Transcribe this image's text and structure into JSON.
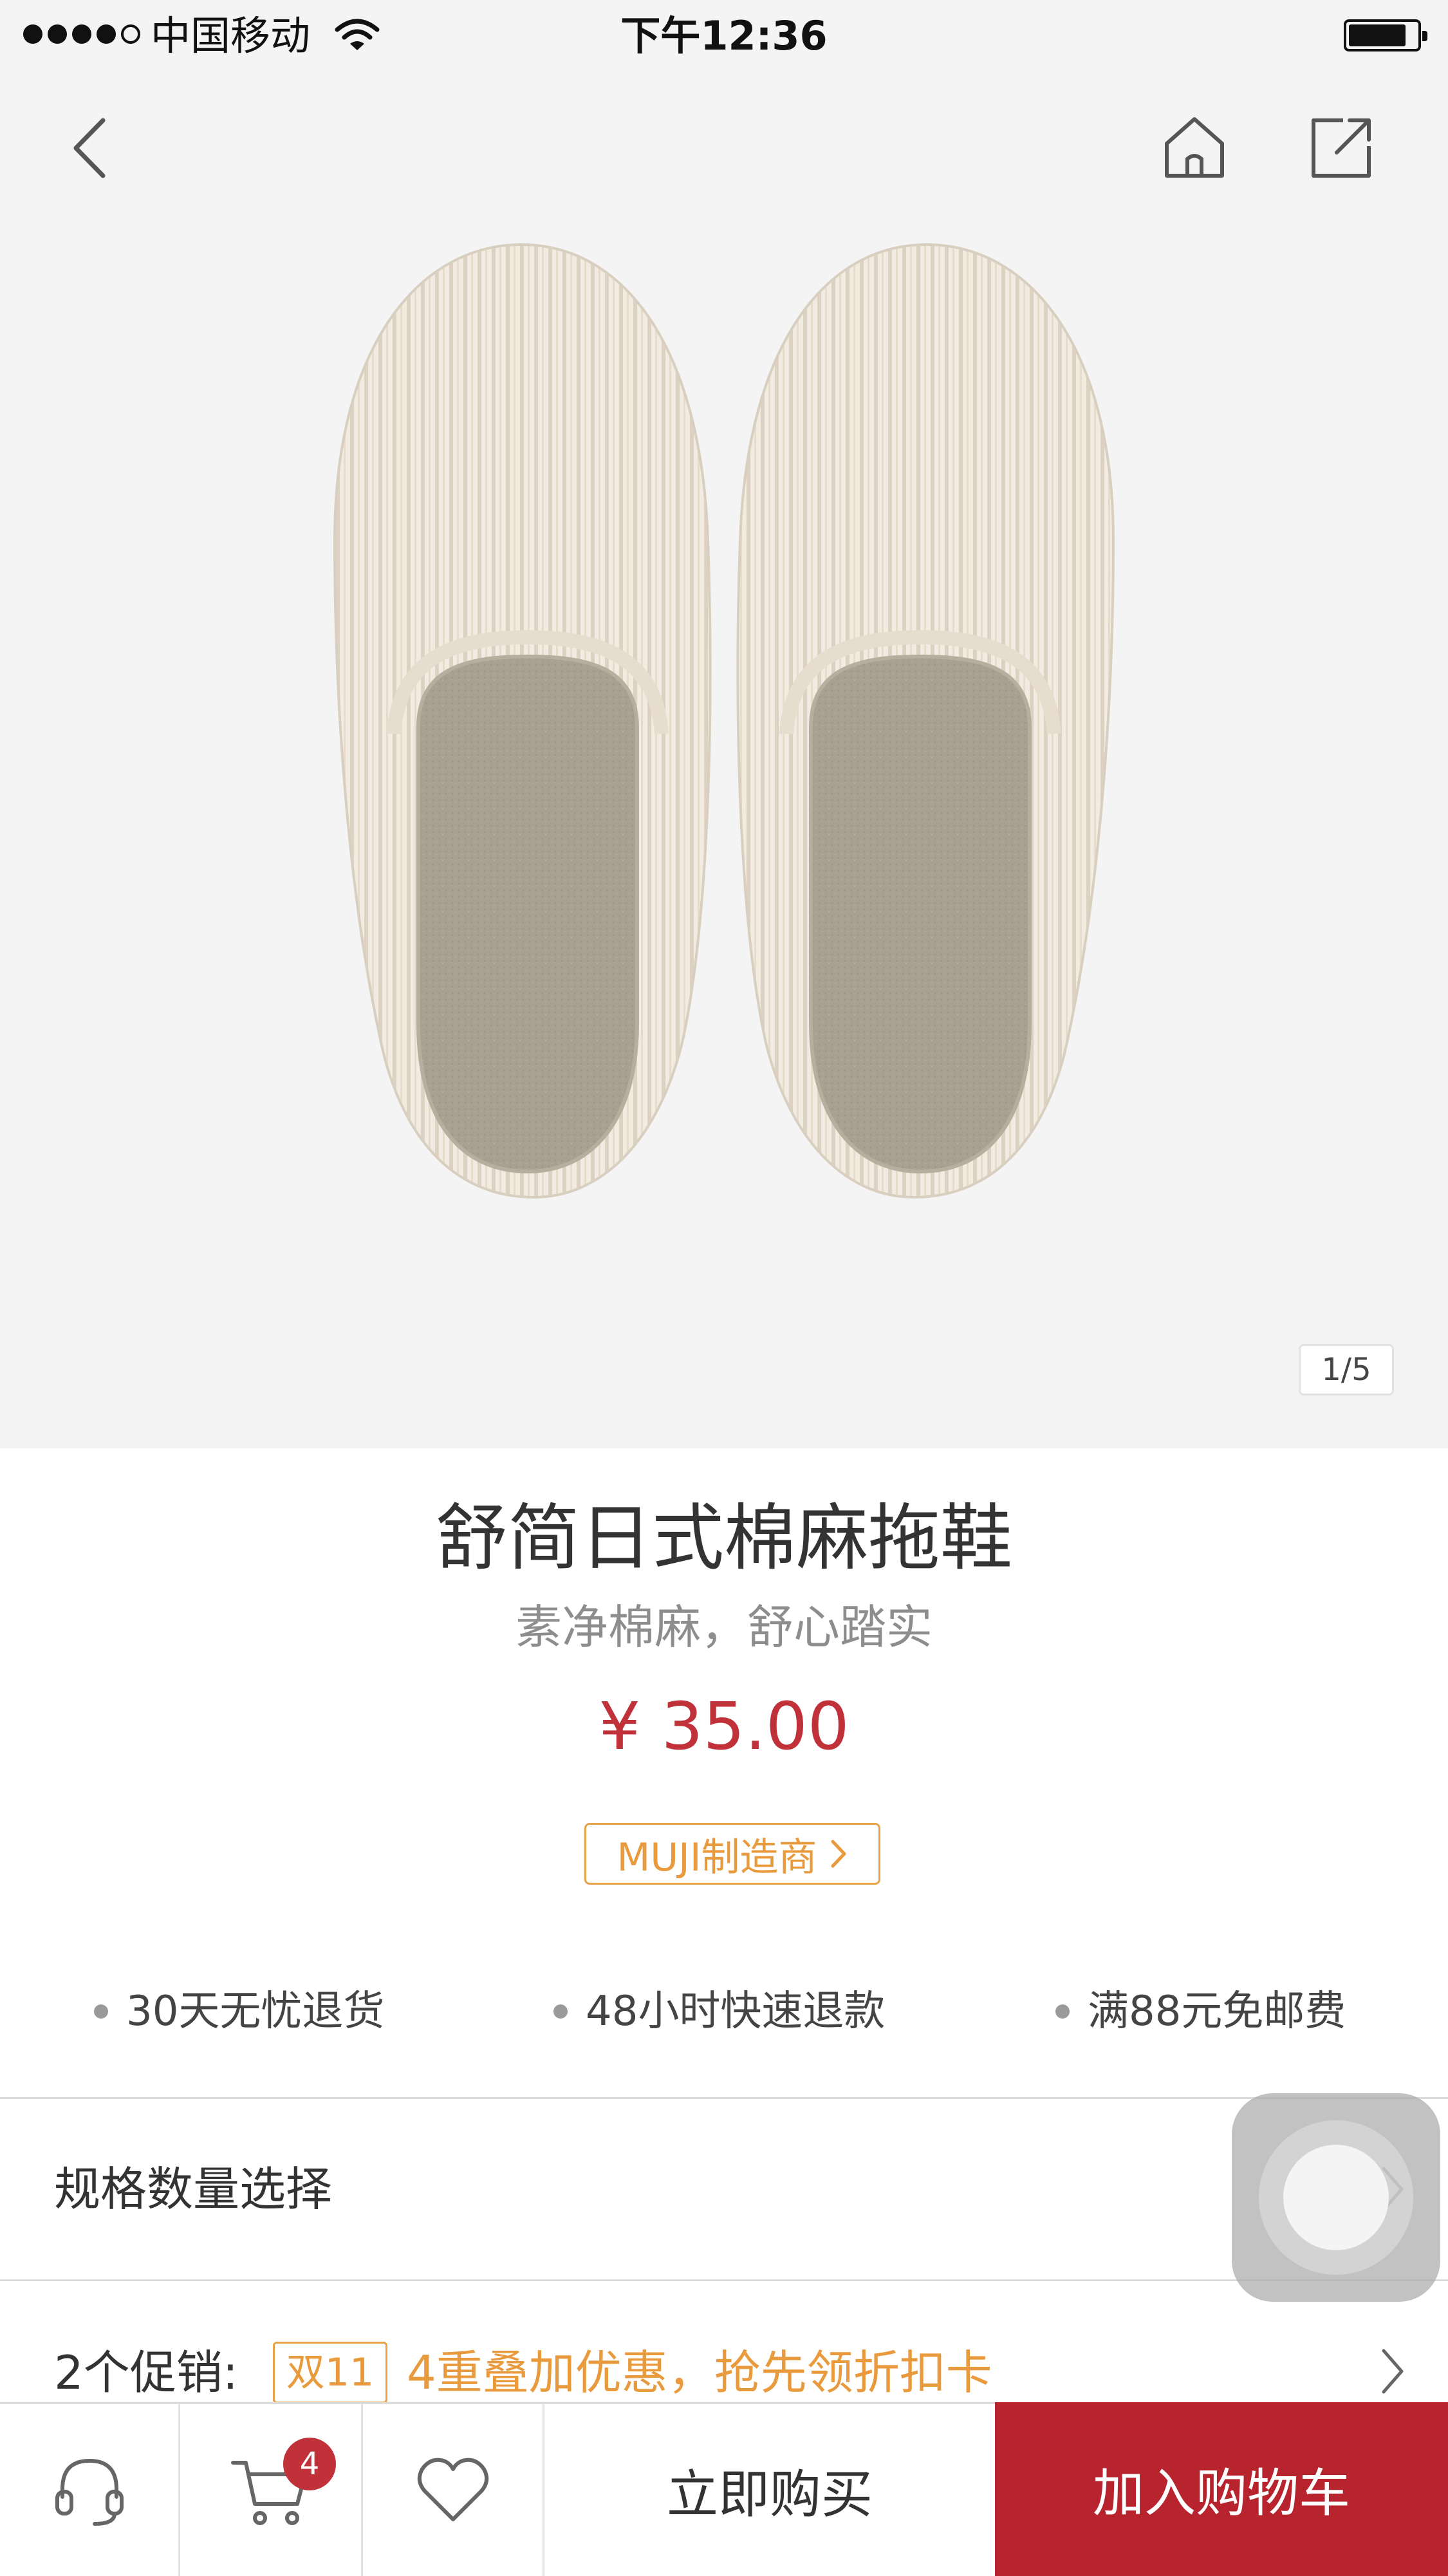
{
  "status_bar": {
    "carrier": "中国移动",
    "time": "下午12:36"
  },
  "gallery": {
    "counter": "1/5",
    "image_alt": "棉麻拖鞋"
  },
  "product": {
    "title": "舒简日式棉麻拖鞋",
    "subtitle": "素净棉麻，舒心踏实",
    "price": "¥ 35.00",
    "maker_tag": "MUJI制造商"
  },
  "services": [
    {
      "label": "30天无忧退货"
    },
    {
      "label": "48小时快速退款"
    },
    {
      "label": "满88元免邮费"
    }
  ],
  "spec_row": {
    "label": "规格数量选择"
  },
  "promo_row": {
    "label": "2个促销:",
    "tag": "双11",
    "text": "4重叠加优惠，抢先领折扣卡"
  },
  "bottom_bar": {
    "cart_count": "4",
    "buy_now": "立即购买",
    "add_to_cart": "加入购物车"
  },
  "colors": {
    "accent_red": "#b7242e",
    "price_red": "#c0313a",
    "promo_orange": "#e89a3c",
    "hero_bg": "#f4f4f4"
  }
}
